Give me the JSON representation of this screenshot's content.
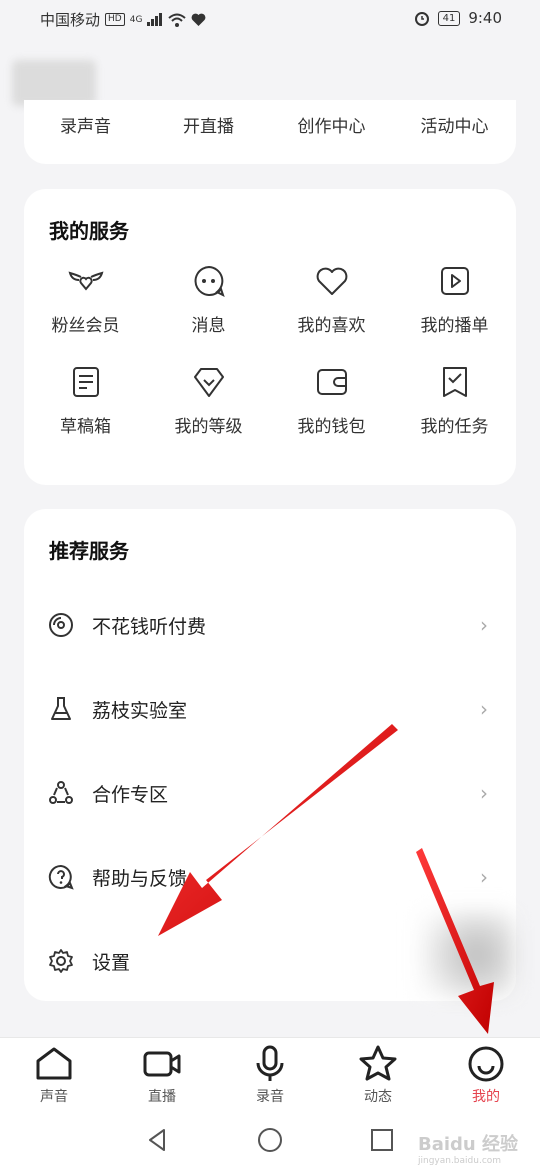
{
  "status_bar": {
    "carrier": "中国移动",
    "hd": "HD",
    "net": "4G",
    "battery": "41",
    "time": "9:40"
  },
  "top_shortcuts": [
    "录声音",
    "开直播",
    "创作中心",
    "活动中心"
  ],
  "my_services": {
    "title": "我的服务",
    "items": [
      {
        "label": "粉丝会员",
        "icon": "wings-heart-icon"
      },
      {
        "label": "消息",
        "icon": "chat-bubble-icon"
      },
      {
        "label": "我的喜欢",
        "icon": "heart-icon"
      },
      {
        "label": "我的播单",
        "icon": "playlist-icon"
      },
      {
        "label": "草稿箱",
        "icon": "draft-icon"
      },
      {
        "label": "我的等级",
        "icon": "diamond-icon"
      },
      {
        "label": "我的钱包",
        "icon": "wallet-icon"
      },
      {
        "label": "我的任务",
        "icon": "task-icon"
      }
    ]
  },
  "recommended": {
    "title": "推荐服务",
    "items": [
      {
        "label": "不花钱听付费",
        "icon": "disc-icon"
      },
      {
        "label": "荔枝实验室",
        "icon": "flask-icon"
      },
      {
        "label": "合作专区",
        "icon": "cooperate-icon"
      },
      {
        "label": "帮助与反馈",
        "icon": "help-icon"
      },
      {
        "label": "设置",
        "icon": "gear-icon"
      }
    ]
  },
  "tabs": [
    {
      "label": "声音",
      "icon": "home-icon"
    },
    {
      "label": "直播",
      "icon": "video-camera-icon"
    },
    {
      "label": "录音",
      "icon": "microphone-icon"
    },
    {
      "label": "动态",
      "icon": "star-icon"
    },
    {
      "label": "我的",
      "icon": "profile-icon",
      "active": true
    }
  ],
  "accent_color": "#e5424d",
  "watermark": {
    "text": "Baidu 经验",
    "sub": "jingyan.baidu.com"
  }
}
